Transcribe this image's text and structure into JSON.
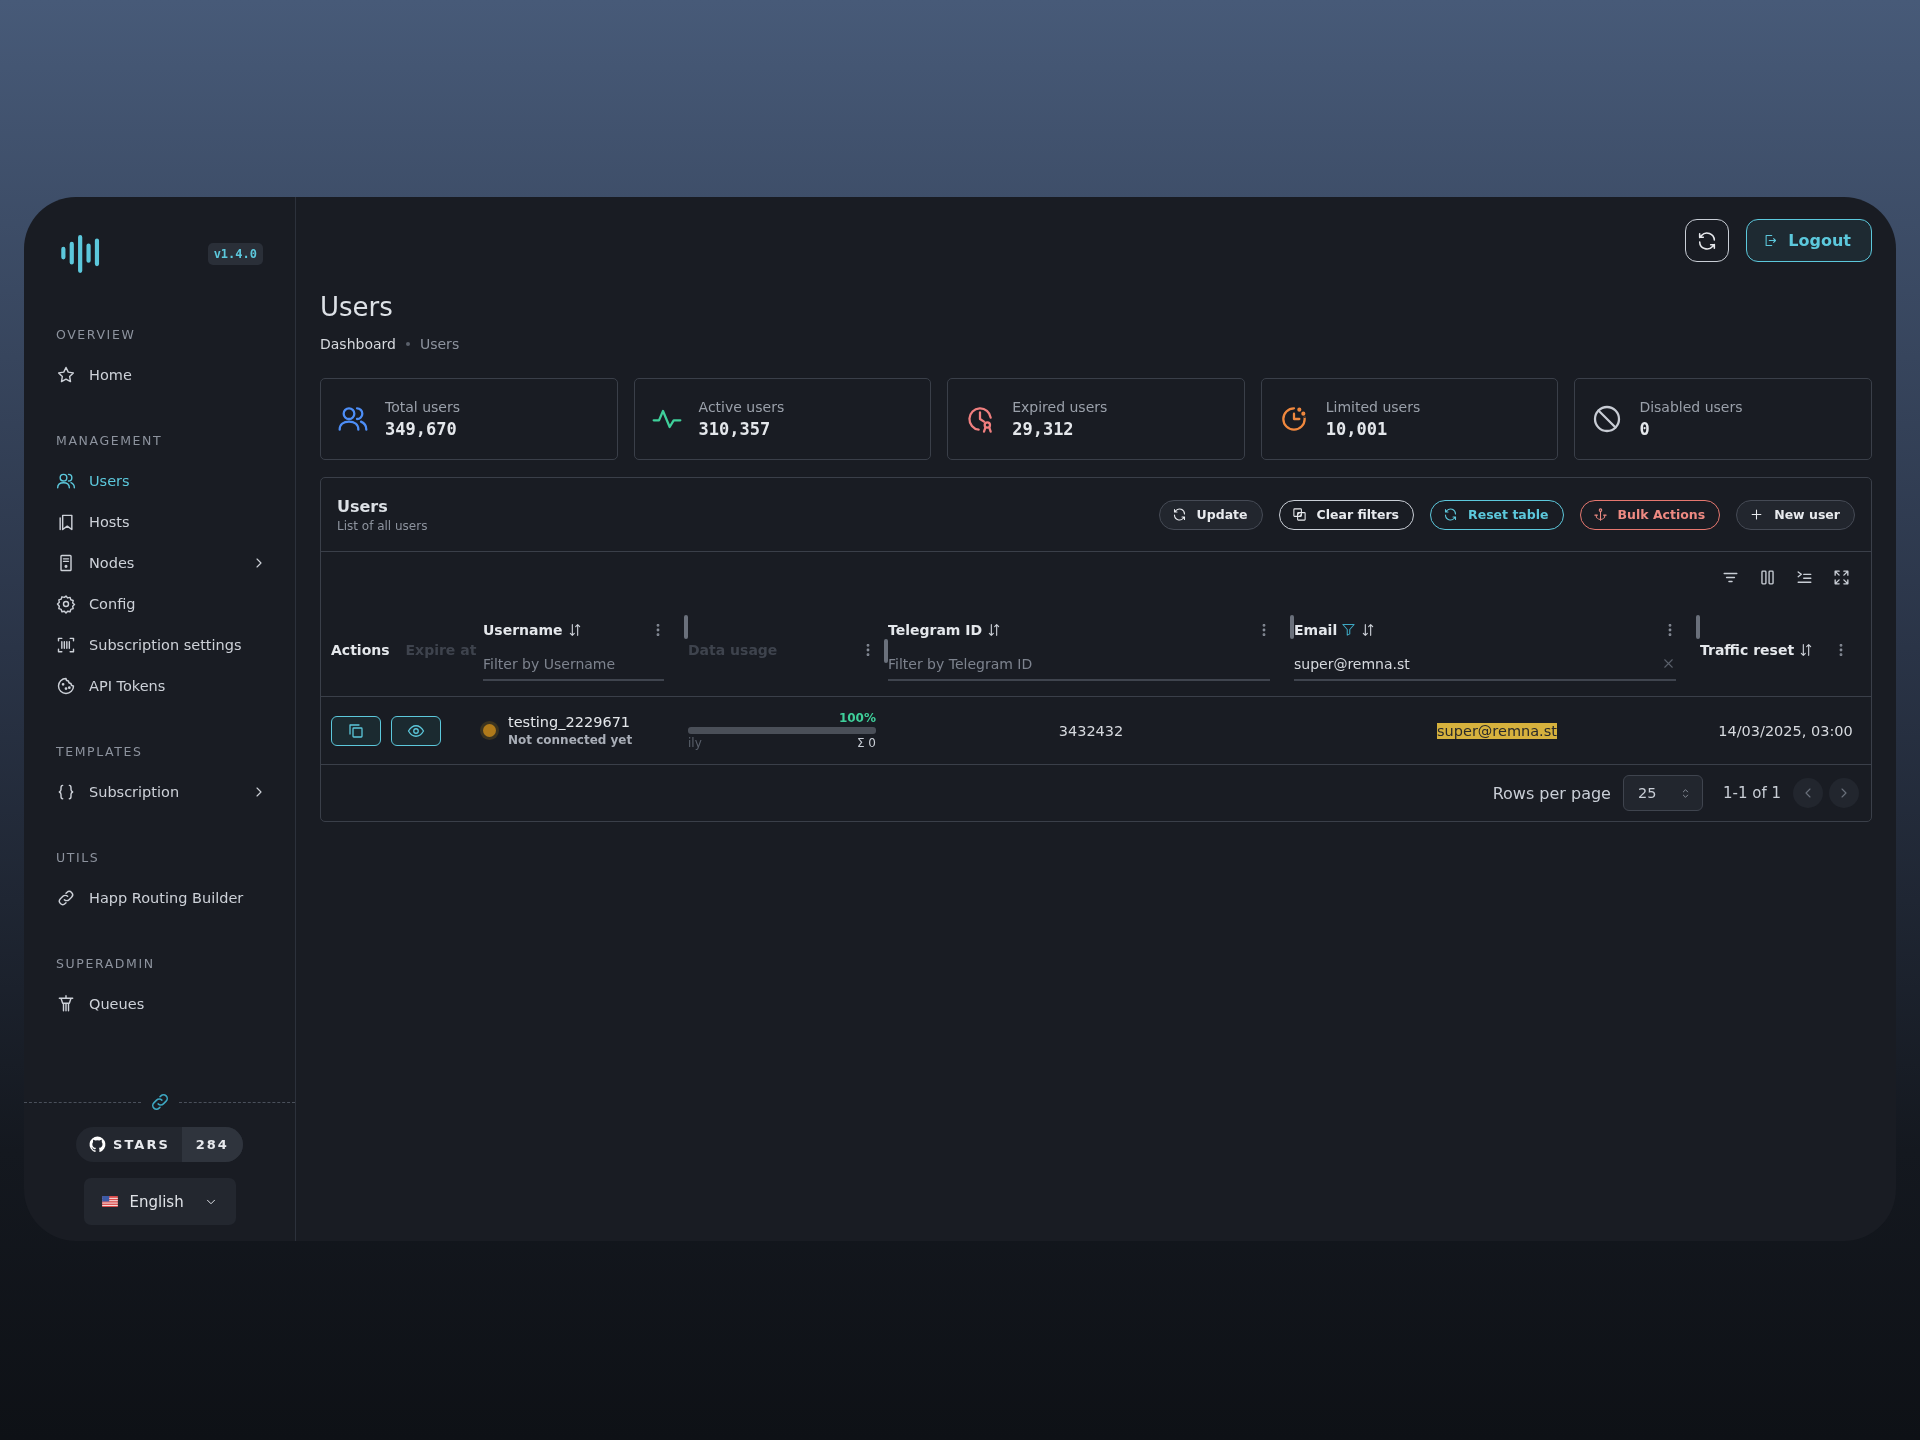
{
  "sidebar": {
    "version": "v1.4.0",
    "sections": [
      {
        "title": "OVERVIEW",
        "items": [
          {
            "label": "Home",
            "kind": "star",
            "selected": false,
            "expandable": false
          }
        ]
      },
      {
        "title": "MANAGEMENT",
        "items": [
          {
            "label": "Users",
            "kind": "users",
            "selected": true,
            "expandable": false
          },
          {
            "label": "Hosts",
            "kind": "bookmark",
            "selected": false,
            "expandable": false
          },
          {
            "label": "Nodes",
            "kind": "server",
            "selected": false,
            "expandable": true
          },
          {
            "label": "Config",
            "kind": "gear",
            "selected": false,
            "expandable": false
          },
          {
            "label": "Subscription settings",
            "kind": "barcode",
            "selected": false,
            "expandable": false
          },
          {
            "label": "API Tokens",
            "kind": "cookie",
            "selected": false,
            "expandable": false
          }
        ]
      },
      {
        "title": "TEMPLATES",
        "items": [
          {
            "label": "Subscription",
            "kind": "braces",
            "selected": false,
            "expandable": true
          }
        ]
      },
      {
        "title": "UTILS",
        "items": [
          {
            "label": "Happ Routing Builder",
            "kind": "link",
            "selected": false,
            "expandable": false
          }
        ]
      },
      {
        "title": "SUPERADMIN",
        "items": [
          {
            "label": "Queues",
            "kind": "queue",
            "selected": false,
            "expandable": false
          }
        ]
      }
    ],
    "github": {
      "label": "STARS",
      "count": "284"
    },
    "language": {
      "label": "English"
    }
  },
  "header": {
    "title": "Users",
    "breadcrumbs": [
      {
        "label": "Dashboard",
        "selected": false
      },
      {
        "label": "Users",
        "selected": true
      }
    ],
    "logout": "Logout"
  },
  "stats": [
    {
      "label": "Total users",
      "value": "349,670",
      "kind": "users",
      "color": "#4d8ef7"
    },
    {
      "label": "Active users",
      "value": "310,357",
      "kind": "pulse",
      "color": "#3fcf9a"
    },
    {
      "label": "Expired users",
      "value": "29,312",
      "kind": "clock-badge",
      "color": "#f07f7f"
    },
    {
      "label": "Limited users",
      "value": "10,001",
      "kind": "clock-dots",
      "color": "#f0883e"
    },
    {
      "label": "Disabled users",
      "value": "0",
      "kind": "forbidden",
      "color": "#c8ccd4"
    }
  ],
  "panel": {
    "title": "Users",
    "subtitle": "List of all users",
    "buttons": [
      {
        "label": "Update",
        "kind": "update"
      },
      {
        "label": "Clear filters",
        "kind": "clear"
      },
      {
        "label": "Reset table",
        "kind": "reset"
      },
      {
        "label": "Bulk Actions",
        "kind": "bulk"
      },
      {
        "label": "New user",
        "kind": "new"
      }
    ]
  },
  "table": {
    "columns": [
      {
        "kind": "actions",
        "label": "Actions",
        "ghost": "Expire at"
      },
      {
        "kind": "filter",
        "label": "Username",
        "placeholder": "Filter by Username"
      },
      {
        "kind": "usage",
        "ghost": "Data usage"
      },
      {
        "kind": "filter",
        "label": "Telegram ID",
        "placeholder": "Filter by Telegram ID"
      },
      {
        "kind": "filter",
        "label": "Email",
        "value": "super@remna.st",
        "filtered": true
      },
      {
        "kind": "plain",
        "label": "Traffic reset"
      }
    ],
    "rows": [
      {
        "username": "testing_2229671",
        "status": "Not connected yet",
        "color": "#b07a1a",
        "usage_percent": "100%",
        "usage_period": "ily",
        "usage_total": "Σ 0",
        "telegram_id": "3432432",
        "email": "super@remna.st",
        "email_highlighted": true,
        "traffic_reset": "14/03/2025, 03:00"
      }
    ],
    "pagination": {
      "label": "Rows per page",
      "page_size": "25",
      "range": "1-1 of 1"
    }
  }
}
